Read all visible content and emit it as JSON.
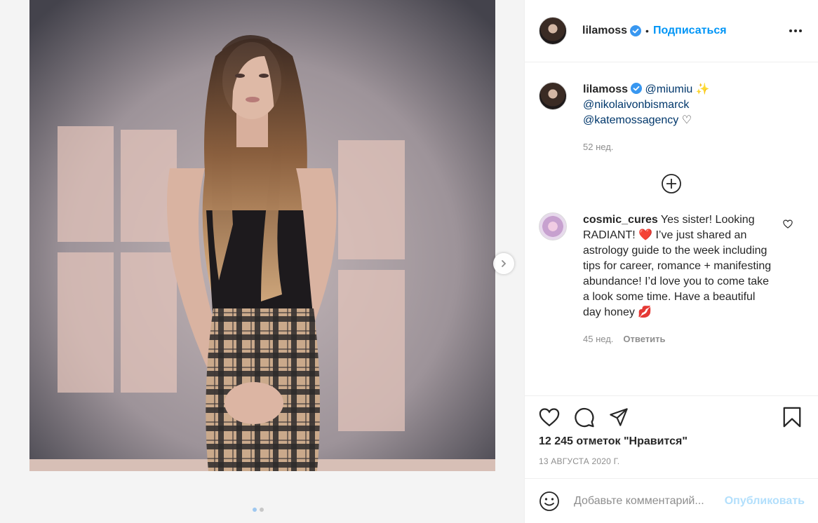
{
  "post": {
    "author": "lilamoss",
    "follow_label": "Подписаться",
    "separator": "•",
    "icons": {
      "verified": "verified-badge-icon",
      "more": "more-options-icon",
      "next": "chevron-right-icon"
    },
    "caption": {
      "username": "lilamoss",
      "mentions": [
        "@miumiu",
        "@nikolaivonbismarck",
        "@katemossagency"
      ],
      "emoji_sparkles": "✨",
      "emoji_heart": "♡",
      "time": "52 нед."
    },
    "comments": [
      {
        "username": "cosmic_cures",
        "text": "Yes sister! Looking RADIANT! ❤️ I’ve just shared an astrology guide to the week including tips for career, romance + manifesting abundance! I’d love you to come take a look some time. Have a beautiful day honey 💋",
        "time": "45 нед.",
        "reply_label": "Ответить"
      }
    ],
    "likes_text": "12 245 отметок \"Нравится\"",
    "date": "13 АВГУСТА 2020 Г.",
    "carousel": {
      "count": 2,
      "active": 0
    }
  },
  "composer": {
    "placeholder": "Добавьте комментарий...",
    "publish_label": "Опубликовать"
  },
  "colors": {
    "accent": "#0095f6",
    "publish_disabled": "#b2dffc",
    "muted": "#8e8e8e",
    "text": "#262626"
  }
}
